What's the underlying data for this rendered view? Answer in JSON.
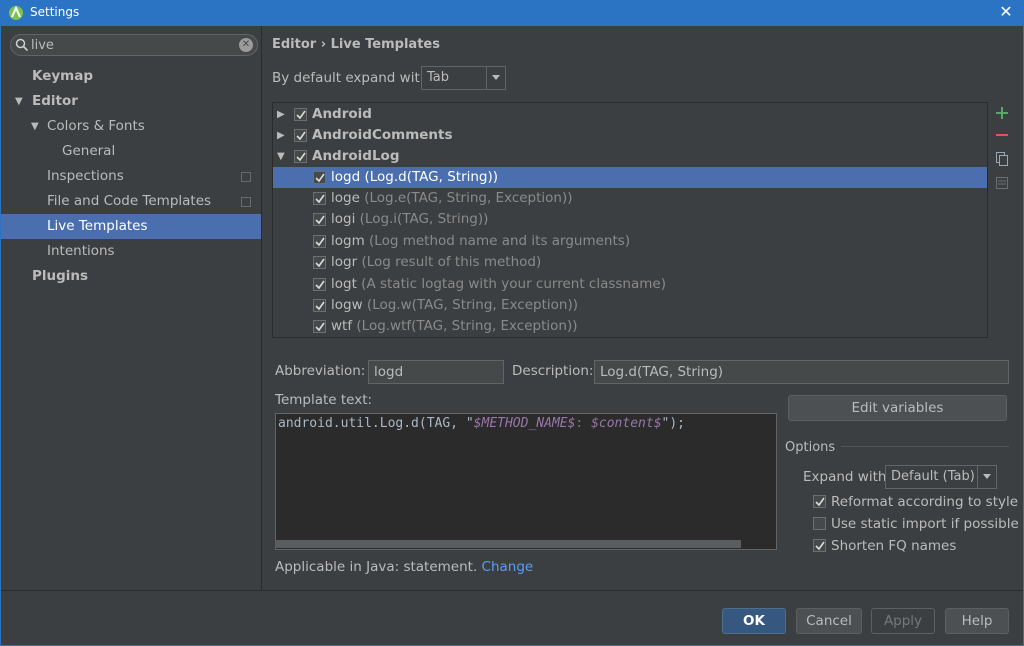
{
  "window": {
    "title": "Settings",
    "icons": {
      "app": "android-studio-icon",
      "close": "close-icon"
    }
  },
  "search": {
    "value": "live"
  },
  "sidebar": {
    "items": [
      {
        "label": "Keymap"
      },
      {
        "label": "Editor"
      },
      {
        "label": "Colors & Fonts"
      },
      {
        "label": "General"
      },
      {
        "label": "Inspections"
      },
      {
        "label": "File and Code Templates"
      },
      {
        "label": "Live Templates"
      },
      {
        "label": "Intentions"
      },
      {
        "label": "Plugins"
      }
    ]
  },
  "main": {
    "breadcrumb": "Editor › Live Templates",
    "expand_label": "By default expand with",
    "expand_value": "Tab",
    "templates": [
      {
        "name": "Android",
        "desc": ""
      },
      {
        "name": "AndroidComments",
        "desc": ""
      },
      {
        "name": "AndroidLog",
        "desc": ""
      },
      {
        "name": "logd",
        "desc": "(Log.d(TAG, String))"
      },
      {
        "name": "loge",
        "desc": "(Log.e(TAG, String, Exception))"
      },
      {
        "name": "logi",
        "desc": "(Log.i(TAG, String))"
      },
      {
        "name": "logm",
        "desc": "(Log method name and its arguments)"
      },
      {
        "name": "logr",
        "desc": "(Log result of this method)"
      },
      {
        "name": "logt",
        "desc": "(A static logtag with your current classname)"
      },
      {
        "name": "logw",
        "desc": "(Log.w(TAG, String, Exception))"
      },
      {
        "name": "wtf",
        "desc": "(Log.wtf(TAG, String, Exception))"
      }
    ],
    "side_buttons": [
      "add-icon",
      "remove-icon",
      "copy-icon",
      "restore-icon"
    ],
    "abbreviation_label": "Abbreviation:",
    "abbreviation_value": "logd",
    "description_label": "Description:",
    "description_value": "Log.d(TAG, String)",
    "template_text_label": "Template text:",
    "template_text": {
      "prefix": "android.util.Log.d(TAG, \"",
      "var1": "$METHOD_NAME$",
      "middle": ": ",
      "var2": "$content$",
      "suffix": "\");"
    },
    "edit_variables": "Edit variables",
    "options_title": "Options",
    "options_expand_label": "Expand with",
    "options_expand_value": "Default (Tab)",
    "options": [
      {
        "label": "Reformat according to style",
        "checked": true
      },
      {
        "label": "Use static import if possible",
        "checked": false
      },
      {
        "label": "Shorten FQ names",
        "checked": true
      }
    ],
    "applicable": "Applicable in Java: statement.",
    "change_link": "Change"
  },
  "footer": {
    "ok": "OK",
    "cancel": "Cancel",
    "apply": "Apply",
    "help": "Help"
  },
  "colors": {
    "accent": "#2b74c4",
    "selection": "#4b6eaf",
    "background": "#3c3f41",
    "link": "#589df6"
  }
}
